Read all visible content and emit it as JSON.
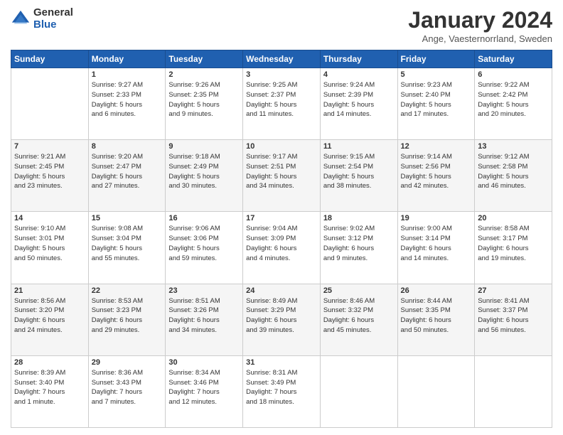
{
  "logo": {
    "general": "General",
    "blue": "Blue"
  },
  "header": {
    "title": "January 2024",
    "subtitle": "Ange, Vaesternorrland, Sweden"
  },
  "weekdays": [
    "Sunday",
    "Monday",
    "Tuesday",
    "Wednesday",
    "Thursday",
    "Friday",
    "Saturday"
  ],
  "weeks": [
    [
      {
        "day": "",
        "info": ""
      },
      {
        "day": "1",
        "info": "Sunrise: 9:27 AM\nSunset: 2:33 PM\nDaylight: 5 hours\nand 6 minutes."
      },
      {
        "day": "2",
        "info": "Sunrise: 9:26 AM\nSunset: 2:35 PM\nDaylight: 5 hours\nand 9 minutes."
      },
      {
        "day": "3",
        "info": "Sunrise: 9:25 AM\nSunset: 2:37 PM\nDaylight: 5 hours\nand 11 minutes."
      },
      {
        "day": "4",
        "info": "Sunrise: 9:24 AM\nSunset: 2:39 PM\nDaylight: 5 hours\nand 14 minutes."
      },
      {
        "day": "5",
        "info": "Sunrise: 9:23 AM\nSunset: 2:40 PM\nDaylight: 5 hours\nand 17 minutes."
      },
      {
        "day": "6",
        "info": "Sunrise: 9:22 AM\nSunset: 2:42 PM\nDaylight: 5 hours\nand 20 minutes."
      }
    ],
    [
      {
        "day": "7",
        "info": "Sunrise: 9:21 AM\nSunset: 2:45 PM\nDaylight: 5 hours\nand 23 minutes."
      },
      {
        "day": "8",
        "info": "Sunrise: 9:20 AM\nSunset: 2:47 PM\nDaylight: 5 hours\nand 27 minutes."
      },
      {
        "day": "9",
        "info": "Sunrise: 9:18 AM\nSunset: 2:49 PM\nDaylight: 5 hours\nand 30 minutes."
      },
      {
        "day": "10",
        "info": "Sunrise: 9:17 AM\nSunset: 2:51 PM\nDaylight: 5 hours\nand 34 minutes."
      },
      {
        "day": "11",
        "info": "Sunrise: 9:15 AM\nSunset: 2:54 PM\nDaylight: 5 hours\nand 38 minutes."
      },
      {
        "day": "12",
        "info": "Sunrise: 9:14 AM\nSunset: 2:56 PM\nDaylight: 5 hours\nand 42 minutes."
      },
      {
        "day": "13",
        "info": "Sunrise: 9:12 AM\nSunset: 2:58 PM\nDaylight: 5 hours\nand 46 minutes."
      }
    ],
    [
      {
        "day": "14",
        "info": "Sunrise: 9:10 AM\nSunset: 3:01 PM\nDaylight: 5 hours\nand 50 minutes."
      },
      {
        "day": "15",
        "info": "Sunrise: 9:08 AM\nSunset: 3:04 PM\nDaylight: 5 hours\nand 55 minutes."
      },
      {
        "day": "16",
        "info": "Sunrise: 9:06 AM\nSunset: 3:06 PM\nDaylight: 5 hours\nand 59 minutes."
      },
      {
        "day": "17",
        "info": "Sunrise: 9:04 AM\nSunset: 3:09 PM\nDaylight: 6 hours\nand 4 minutes."
      },
      {
        "day": "18",
        "info": "Sunrise: 9:02 AM\nSunset: 3:12 PM\nDaylight: 6 hours\nand 9 minutes."
      },
      {
        "day": "19",
        "info": "Sunrise: 9:00 AM\nSunset: 3:14 PM\nDaylight: 6 hours\nand 14 minutes."
      },
      {
        "day": "20",
        "info": "Sunrise: 8:58 AM\nSunset: 3:17 PM\nDaylight: 6 hours\nand 19 minutes."
      }
    ],
    [
      {
        "day": "21",
        "info": "Sunrise: 8:56 AM\nSunset: 3:20 PM\nDaylight: 6 hours\nand 24 minutes."
      },
      {
        "day": "22",
        "info": "Sunrise: 8:53 AM\nSunset: 3:23 PM\nDaylight: 6 hours\nand 29 minutes."
      },
      {
        "day": "23",
        "info": "Sunrise: 8:51 AM\nSunset: 3:26 PM\nDaylight: 6 hours\nand 34 minutes."
      },
      {
        "day": "24",
        "info": "Sunrise: 8:49 AM\nSunset: 3:29 PM\nDaylight: 6 hours\nand 39 minutes."
      },
      {
        "day": "25",
        "info": "Sunrise: 8:46 AM\nSunset: 3:32 PM\nDaylight: 6 hours\nand 45 minutes."
      },
      {
        "day": "26",
        "info": "Sunrise: 8:44 AM\nSunset: 3:35 PM\nDaylight: 6 hours\nand 50 minutes."
      },
      {
        "day": "27",
        "info": "Sunrise: 8:41 AM\nSunset: 3:37 PM\nDaylight: 6 hours\nand 56 minutes."
      }
    ],
    [
      {
        "day": "28",
        "info": "Sunrise: 8:39 AM\nSunset: 3:40 PM\nDaylight: 7 hours\nand 1 minute."
      },
      {
        "day": "29",
        "info": "Sunrise: 8:36 AM\nSunset: 3:43 PM\nDaylight: 7 hours\nand 7 minutes."
      },
      {
        "day": "30",
        "info": "Sunrise: 8:34 AM\nSunset: 3:46 PM\nDaylight: 7 hours\nand 12 minutes."
      },
      {
        "day": "31",
        "info": "Sunrise: 8:31 AM\nSunset: 3:49 PM\nDaylight: 7 hours\nand 18 minutes."
      },
      {
        "day": "",
        "info": ""
      },
      {
        "day": "",
        "info": ""
      },
      {
        "day": "",
        "info": ""
      }
    ]
  ]
}
